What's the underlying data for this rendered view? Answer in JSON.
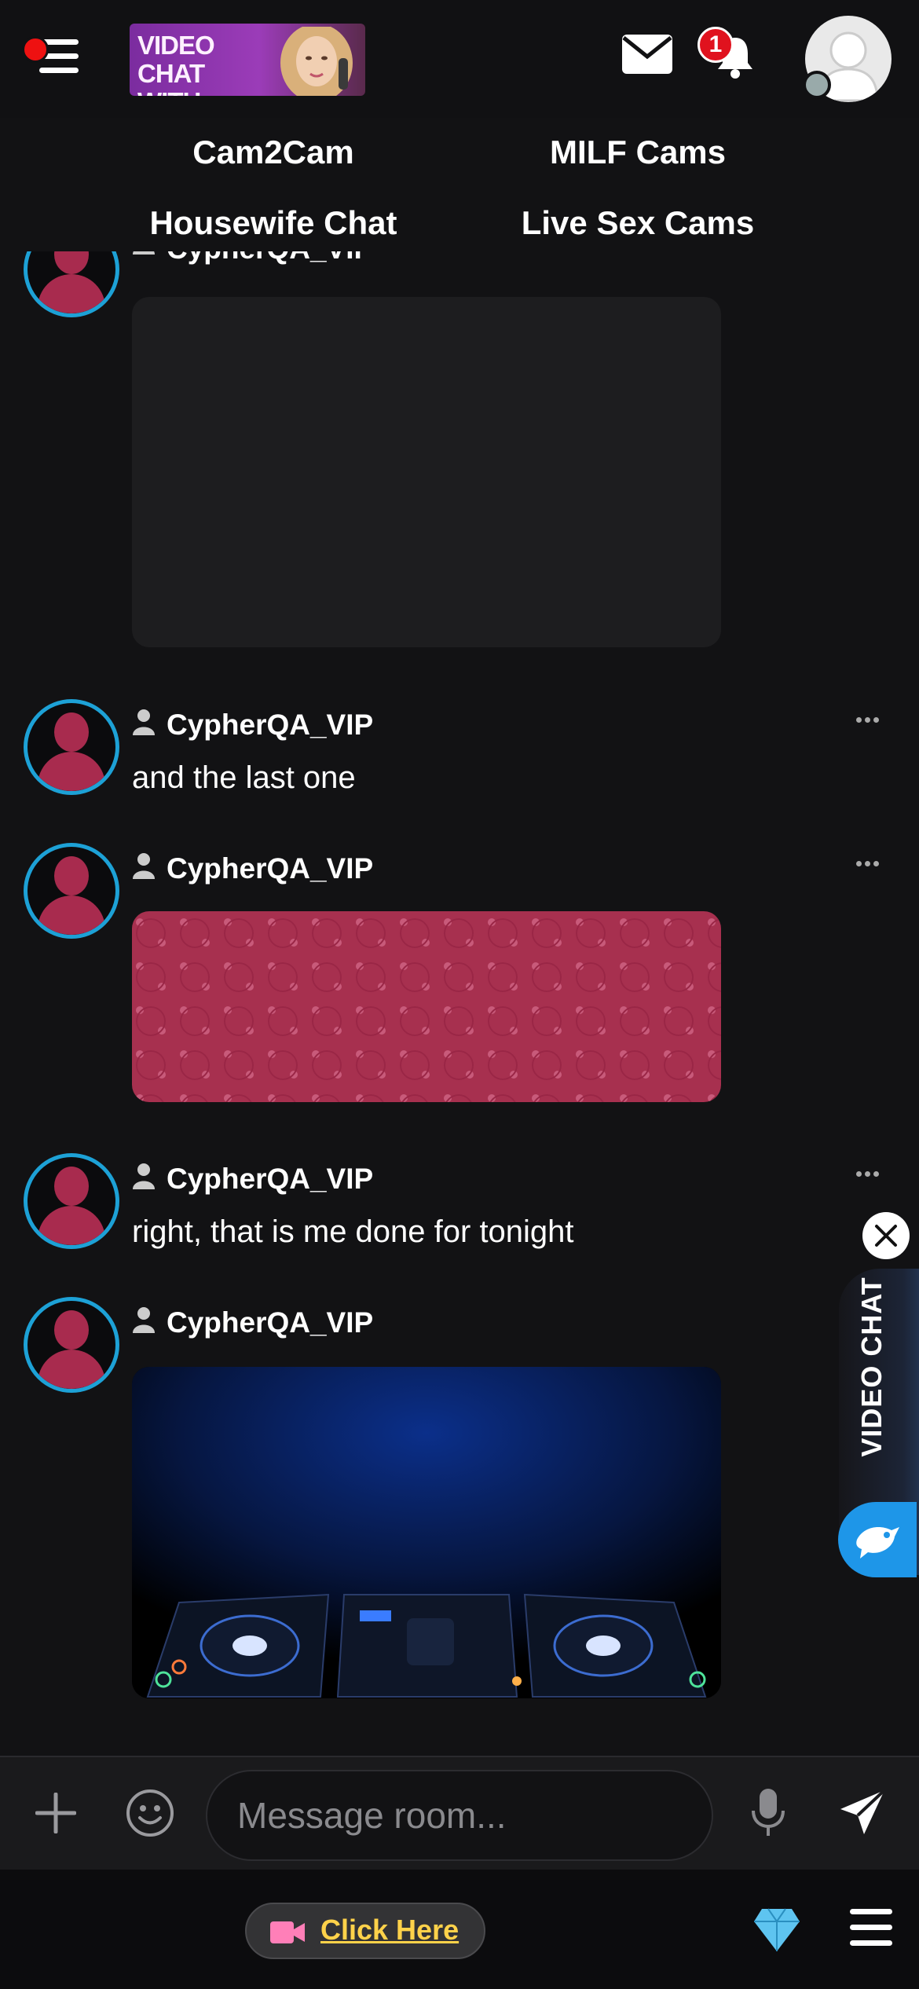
{
  "header": {
    "banner_text": "VIDEO CHAT WITH GIRLS",
    "notification_count": "1"
  },
  "nav": {
    "links": [
      "Cam2Cam",
      "MILF Cams",
      "Housewife Chat",
      "Live Sex Cams"
    ]
  },
  "messages": [
    {
      "username": "CypherQA_VIP",
      "type": "image",
      "image_desc": "blank-dark"
    },
    {
      "username": "CypherQA_VIP",
      "type": "text",
      "text": "and the last one"
    },
    {
      "username": "CypherQA_VIP",
      "type": "image",
      "image_desc": "pink-pattern"
    },
    {
      "username": "CypherQA_VIP",
      "type": "text",
      "text": "right, that is me done for tonight"
    },
    {
      "username": "CypherQA_VIP",
      "type": "image",
      "image_desc": "dj-decks"
    }
  ],
  "video_chat_widget": {
    "label": "VIDEO CHAT"
  },
  "composer": {
    "placeholder": "Message room..."
  },
  "bottom_bar": {
    "cta_label": "Click Here"
  },
  "colors": {
    "avatar_ring": "#1da1d6",
    "avatar_fill": "#a82b4e",
    "cta_text": "#ffd24a",
    "badge": "#e0121e",
    "widget_bird": "#1e96e8"
  }
}
